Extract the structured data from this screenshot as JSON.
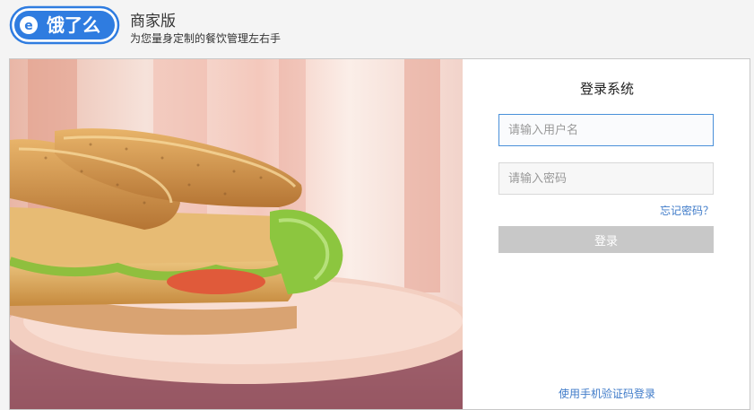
{
  "header": {
    "logo_text": "饿了么",
    "title": "商家版",
    "subtitle": "为您量身定制的餐饮管理左右手"
  },
  "login": {
    "title": "登录系统",
    "username_placeholder": "请输入用户名",
    "password_placeholder": "请输入密码",
    "forgot_label": "忘记密码？",
    "submit_label": "登录",
    "sms_login_label": "使用手机验证码登录"
  },
  "colors": {
    "brand_blue": "#2f7ce0",
    "link_blue": "#3f7bc9",
    "button_disabled": "#c8c8c8"
  }
}
